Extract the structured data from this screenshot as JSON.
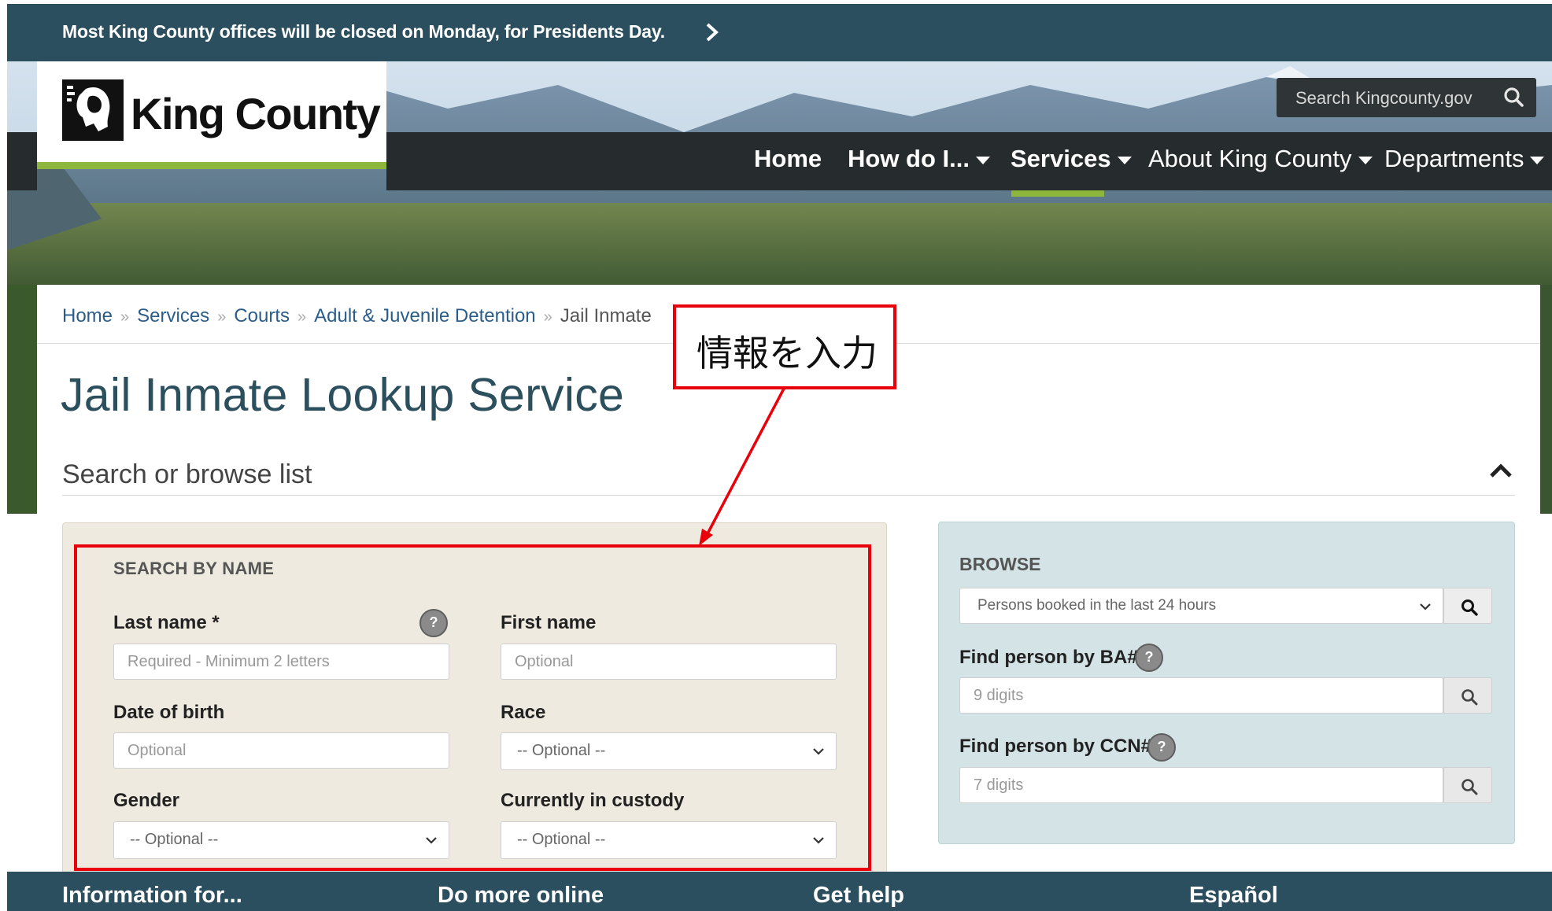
{
  "alert": {
    "text": "Most King County offices will be closed on Monday, for Presidents Day."
  },
  "header": {
    "logo_text": "King County",
    "search_placeholder": "Search Kingcounty.gov",
    "nav": [
      {
        "label": "Home"
      },
      {
        "label": "How do I..."
      },
      {
        "label": "Services"
      },
      {
        "label": "About King County"
      },
      {
        "label": "Departments"
      }
    ]
  },
  "breadcrumb": [
    "Home",
    "Services",
    "Courts",
    "Adult & Juvenile Detention",
    "Jail Inmate"
  ],
  "page_title": "Jail Inmate Lookup Service",
  "section_heading": "Search or browse list",
  "search_by_name": {
    "heading": "SEARCH BY NAME",
    "last_name_label": "Last name *",
    "last_name_placeholder": "Required - Minimum 2 letters",
    "first_name_label": "First name",
    "first_name_placeholder": "Optional",
    "dob_label": "Date of birth",
    "dob_placeholder": "Optional",
    "race_label": "Race",
    "race_value": "-- Optional --",
    "gender_label": "Gender",
    "gender_value": "-- Optional --",
    "custody_label": "Currently in custody",
    "custody_value": "-- Optional --",
    "help": "?"
  },
  "browse": {
    "heading": "BROWSE",
    "select_value": "Persons booked in the last 24 hours",
    "ba_label": "Find person by BA#",
    "ba_placeholder": "9 digits",
    "ccn_label": "Find person by CCN#",
    "ccn_placeholder": "7 digits",
    "help": "?"
  },
  "annotation": {
    "text": "情報を入力",
    "color": "#e8000a"
  },
  "footer": [
    "Information for...",
    "Do more online",
    "Get help",
    "Español"
  ],
  "colors": {
    "brand_teal": "#2b4f5e",
    "accent_green": "#8cb73c",
    "nav_dark": "#262b2d"
  }
}
